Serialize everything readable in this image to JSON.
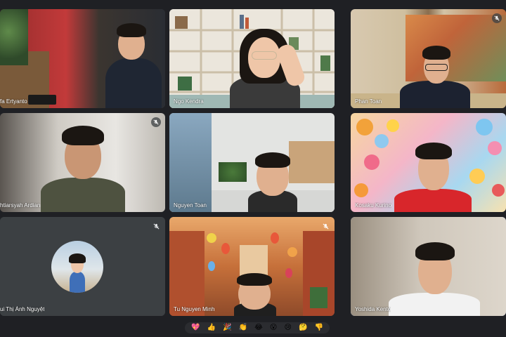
{
  "participants": [
    {
      "name": "fa Ertyanto",
      "mic": "none"
    },
    {
      "name": "Ngo Kendra",
      "mic": "none"
    },
    {
      "name": "Phan Toan",
      "mic": "muted"
    },
    {
      "name": "htiarsyah Ardian",
      "mic": "muted"
    },
    {
      "name": "Nguyen Toan",
      "mic": "none"
    },
    {
      "name": "Kosaku Kurino",
      "mic": "none"
    },
    {
      "name": "ui Thị Ánh Nguyệt",
      "mic": "muted"
    },
    {
      "name": "Tu Nguyen Minh",
      "mic": "muted"
    },
    {
      "name": "Yoshida Kento",
      "mic": "none"
    }
  ],
  "reactions": [
    {
      "emoji": "💖",
      "icon": "sparkling-heart-icon"
    },
    {
      "emoji": "👍",
      "icon": "thumbs-up-icon"
    },
    {
      "emoji": "🎉",
      "icon": "party-popper-icon"
    },
    {
      "emoji": "👏",
      "icon": "clapping-hands-icon"
    },
    {
      "emoji": "😂",
      "icon": "tears-of-joy-icon"
    },
    {
      "emoji": "😮",
      "icon": "surprised-face-icon"
    },
    {
      "emoji": "😢",
      "icon": "crying-face-icon"
    },
    {
      "emoji": "🤔",
      "icon": "thinking-face-icon"
    },
    {
      "emoji": "👎",
      "icon": "thumbs-down-icon"
    }
  ],
  "colors": {
    "stage": "#1f2024",
    "tile_empty": "#3c4043",
    "active_border": "#8ab4f8"
  }
}
